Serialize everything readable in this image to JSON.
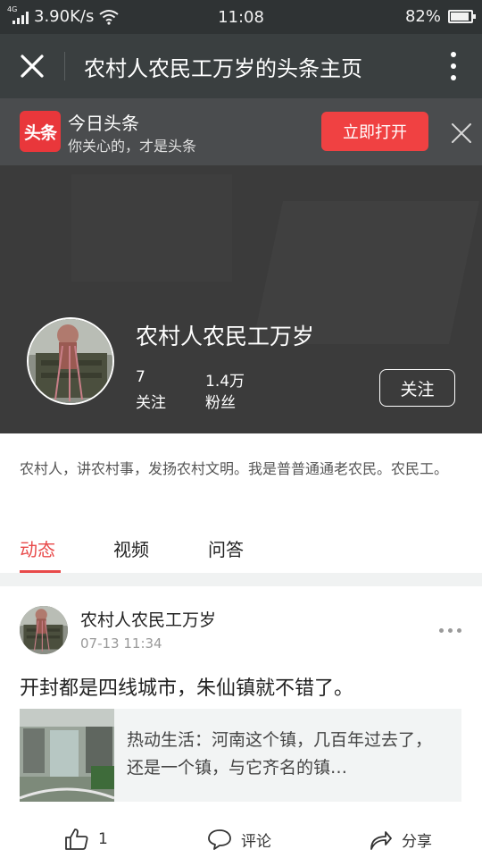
{
  "status_bar": {
    "network_type": "4G",
    "speed": "3.90K/s",
    "time": "11:08",
    "battery_percent": "82%",
    "battery_level": 0.82
  },
  "title_bar": {
    "title": "农村人农民工万岁的头条主页"
  },
  "app_banner": {
    "logo_text": "头条",
    "app_name": "今日头条",
    "slogan": "你关心的，才是头条",
    "open_button": "立即打开"
  },
  "profile": {
    "name": "农村人农民工万岁",
    "following_count": "7",
    "following_label": "关注",
    "followers_count": "1.4万",
    "followers_label": "粉丝",
    "follow_button": "关注",
    "bio": "农村人，讲农村事，发扬农村文明。我是普普通通老农民。农民工。"
  },
  "tabs": [
    {
      "label": "动态",
      "active": true
    },
    {
      "label": "视频",
      "active": false
    },
    {
      "label": "问答",
      "active": false
    }
  ],
  "post": {
    "author": "农村人农民工万岁",
    "time": "07-13 11:34",
    "text": "开封都是四线城市，朱仙镇就不错了。",
    "link_title": "热动生活：河南这个镇，几百年过去了，还是一个镇，与它齐名的镇…",
    "like_count": "1",
    "comment_label": "评论",
    "share_label": "分享"
  },
  "colors": {
    "accent_red": "#e84a4a",
    "open_button_red": "#f04142",
    "title_bar_bg": "#3a3f40",
    "profile_header_bg": "#3b3b3b"
  }
}
